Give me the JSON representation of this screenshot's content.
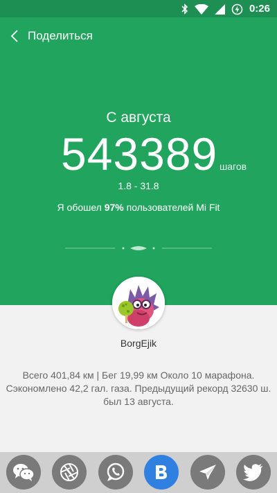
{
  "status_bar": {
    "time": "0:26",
    "icons": [
      "bluetooth-icon",
      "wifi-icon",
      "signal-icon",
      "battery-charging-icon"
    ]
  },
  "header": {
    "title": "Поделиться",
    "back_icon": "chevron-left-icon"
  },
  "stats": {
    "period_label": "С августа",
    "steps": "543389",
    "steps_unit": "шагов",
    "date_range": "1.8 - 31.8",
    "percentile_prefix": "Я обошел ",
    "percentile_value": "97%",
    "percentile_suffix": " пользователей Mi Fit"
  },
  "profile": {
    "username": "BorgEjik",
    "avatar": "hedgehog-avatar"
  },
  "summary": {
    "text": "Всего 401,84 км | Бег 19,99 км  Около 10 марафона. Сэкономлено 42,2 гал. газа. Предыдущий рекорд 32630 ш. был 13 августа."
  },
  "share_buttons": [
    "wechat-icon",
    "camera-aperture-icon",
    "whatsapp-icon",
    "vk-icon",
    "telegram-icon",
    "twitter-icon"
  ],
  "colors": {
    "header_green": "#21a45e",
    "statusbar_green": "#1d8f52",
    "share_button_gray": "#7a7a7a",
    "vk_blue": "#2f80e0",
    "background": "#f2f2f2"
  }
}
